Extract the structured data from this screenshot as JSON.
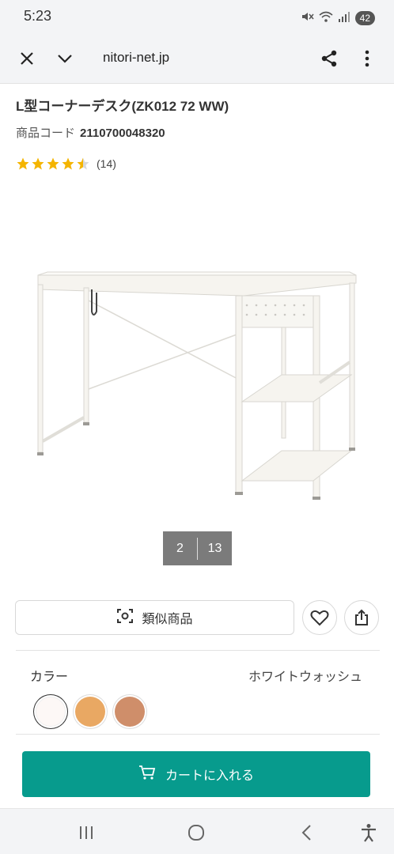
{
  "status_bar": {
    "time": "5:23",
    "battery": "42"
  },
  "browser": {
    "url": "nitori-net.jp"
  },
  "product": {
    "title": "L型コーナーデスク(ZK012 72 WW)",
    "code_label": "商品コード",
    "code_value": "2110700048320",
    "rating": 4.5,
    "review_count": "(14)"
  },
  "gallery": {
    "current": "2",
    "total": "13"
  },
  "actions": {
    "similar_label": "類似商品"
  },
  "color": {
    "label": "カラー",
    "selected_name": "ホワイトウォッシュ",
    "swatches": [
      "#fdf8f6",
      "#e9a863",
      "#cf8e6a"
    ]
  },
  "cart": {
    "label": "カートに入れる"
  },
  "colors": {
    "accent": "#079b8d",
    "star": "#f4b400"
  }
}
